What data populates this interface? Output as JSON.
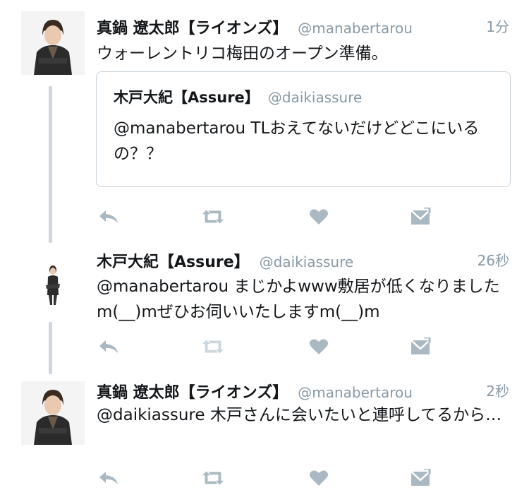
{
  "tweets": [
    {
      "name": "真鍋 遼太郎【ライオンズ】",
      "handle": "@manabertarou",
      "time": "1分",
      "text": "ウォーレントリコ梅田のオープン準備。",
      "quote": {
        "name": "木戸大紀【Assure】",
        "handle": "@daikiassure",
        "text": "@manabertarou TLおえてないだけどどこにいるの？？"
      }
    },
    {
      "name": "木戸大紀【Assure】",
      "handle": "@daikiassure",
      "time": "26秒",
      "text": "@manabertarou まじかよwww敷居が低くなりましたm(__)mぜひお伺いいたしますm(__)m"
    },
    {
      "name": "真鍋 遼太郎【ライオンズ】",
      "handle": "@manabertarou",
      "time": "2秒",
      "text": "@daikiassure 木戸さんに会いたいと連呼してるから…"
    }
  ],
  "icons": [
    "reply-icon",
    "retweet-icon",
    "like-icon",
    "direct-message-icon"
  ],
  "colors": {
    "icon": "#aab8c2",
    "muted_text": "#8899a6",
    "thread_line": "#ccd6dd",
    "quote_border": "#c8d2d9"
  }
}
